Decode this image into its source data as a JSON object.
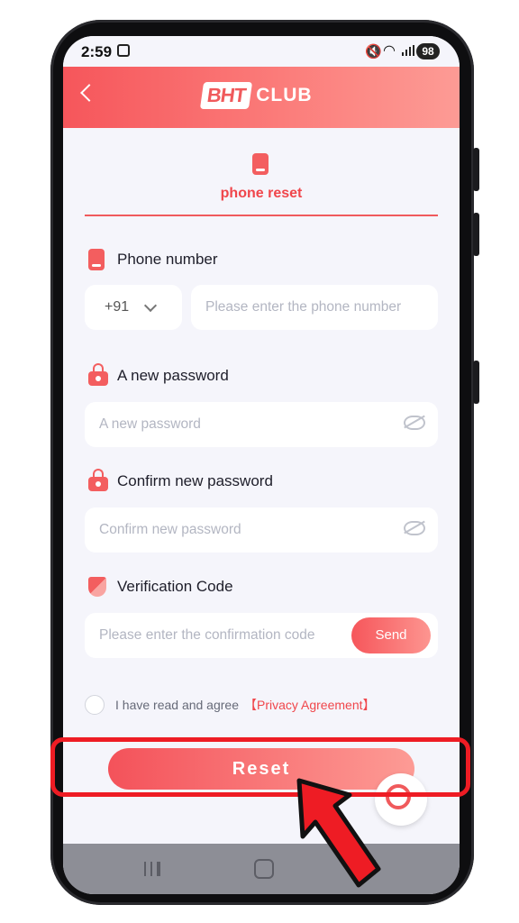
{
  "status_bar": {
    "time": "2:59",
    "battery": "98"
  },
  "header": {
    "logo_mark": "BHT",
    "logo_text": "CLUB"
  },
  "tab": {
    "label": "phone reset"
  },
  "phone": {
    "label": "Phone number",
    "country_code": "+91",
    "placeholder": "Please enter the phone number"
  },
  "new_password": {
    "label": "A new password",
    "placeholder": "A new password"
  },
  "confirm_password": {
    "label": "Confirm new password",
    "placeholder": "Confirm new password"
  },
  "verification": {
    "label": "Verification Code",
    "placeholder": "Please enter the confirmation code",
    "send_label": "Send"
  },
  "agreement": {
    "text": "I have read and agree",
    "link": "【Privacy Agreement】"
  },
  "reset_label": "Reset",
  "colors": {
    "accent": "#f05a5c",
    "highlight": "#ee1c24"
  }
}
